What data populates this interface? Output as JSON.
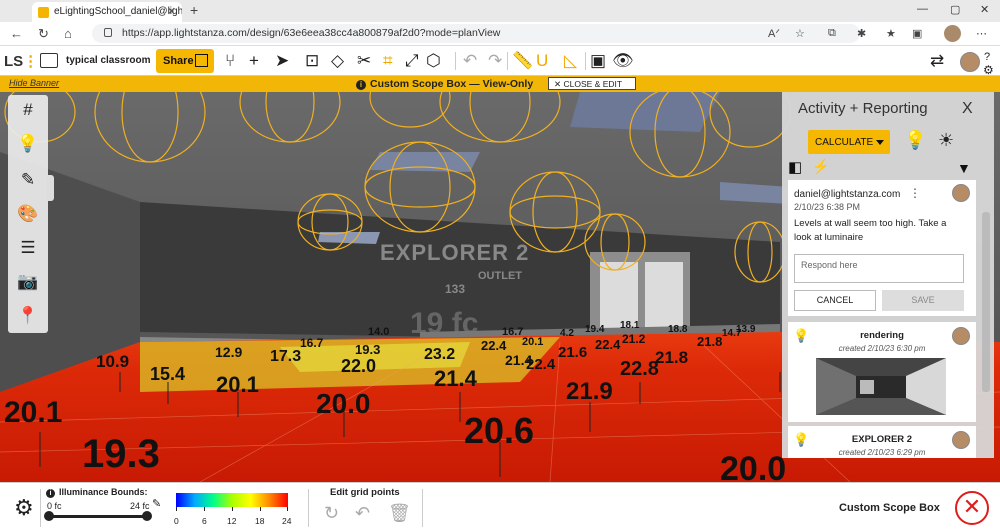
{
  "browser": {
    "tab_title": "eLightingSchool_daniel@lightsta",
    "url": "https://app.lightstanza.com/design/63e6eea38cc4a800879af2d0?mode=planView"
  },
  "toolbar": {
    "logo": "LS",
    "project_name": "typical classroom",
    "share_label": "Share"
  },
  "banner": {
    "hide_label": "Hide Banner",
    "title": "Custom Scope Box — View-Only",
    "close_edit_label": "CLOSE & EDIT"
  },
  "scene": {
    "center_label": "19 fc",
    "sign_text": "EXPLORER 2",
    "sign_sub": "OUTLET",
    "sign_num": "133",
    "values": [
      "10.9",
      "15.4",
      "12.9",
      "17.3",
      "16.7",
      "20.1",
      "22.0",
      "19.3",
      "14.0",
      "23.2",
      "22.4",
      "16.7",
      "20.1",
      "21.4",
      "21.6",
      "22.4",
      "21.2",
      "19.4",
      "18.8",
      "18.1",
      "21.8",
      "21.8",
      "20.0",
      "21.4",
      "21.9",
      "22.8",
      "20.6",
      "19.3",
      "20.1",
      "20.0",
      "22.4",
      "4.2",
      "14.7",
      "13.9"
    ]
  },
  "panel": {
    "title": "Activity + Reporting",
    "calculate_label": "CALCULATE",
    "comment": {
      "user": "daniel@lightstanza.com",
      "date": "2/10/23 6:38 PM",
      "message": "Levels at wall seem too high. Take a look at luminaire",
      "respond_placeholder": "Respond here",
      "cancel_label": "CANCEL",
      "save_label": "SAVE"
    },
    "renderings": [
      {
        "title": "rendering",
        "created": "created 2/10/23 6:30 pm"
      },
      {
        "title": "EXPLORER 2",
        "created": "created 2/10/23 6:29 pm"
      }
    ]
  },
  "bottom": {
    "illuminance_label": "Illuminance Bounds:",
    "min_label": "0 fc",
    "max_label": "24 fc",
    "gradient_ticks": [
      "0",
      "6",
      "12",
      "18",
      "24"
    ],
    "edit_grid_label": "Edit grid points",
    "scope_label": "Custom Scope Box"
  },
  "colors": {
    "accent": "#f5b700",
    "banner": "#f2b607",
    "danger": "#e01b1b"
  }
}
